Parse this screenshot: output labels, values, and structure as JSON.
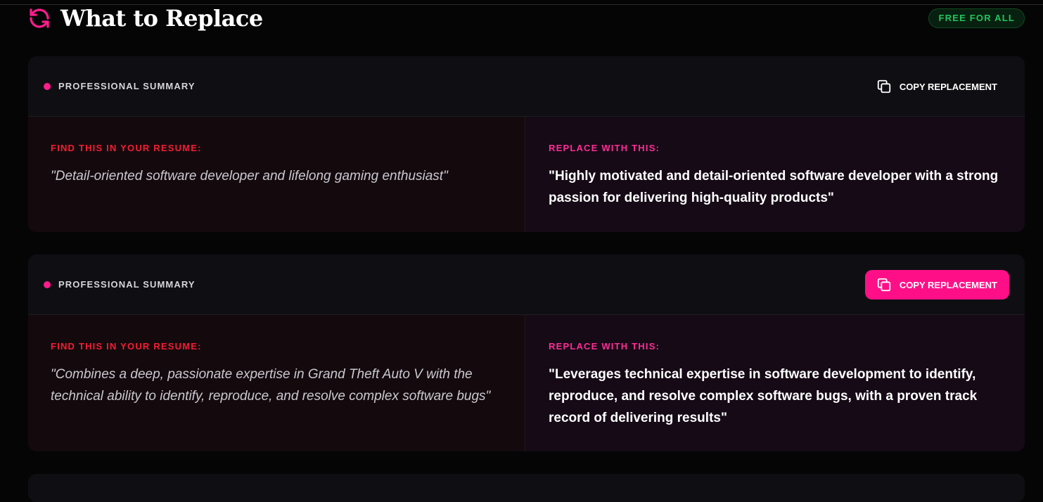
{
  "header": {
    "title": "What to Replace",
    "badge": "FREE FOR ALL",
    "icon": "refresh-icon"
  },
  "colors": {
    "accent": "#ff0f87",
    "find_label": "#f51d33",
    "badge_text": "#22c55e",
    "background": "#050506",
    "card": "#0f0f13"
  },
  "cards": [
    {
      "section": "PROFESSIONAL SUMMARY",
      "copy_label": "COPY REPLACEMENT",
      "find_label": "FIND THIS IN YOUR RESUME:",
      "find_text": "\"Detail-oriented software developer and lifelong gaming enthusiast\"",
      "replace_label": "REPLACE WITH THIS:",
      "replace_text": "\"Highly motivated and detail-oriented software developer with a strong passion for delivering high-quality products\""
    },
    {
      "section": "PROFESSIONAL SUMMARY",
      "copy_label": "COPY REPLACEMENT",
      "find_label": "FIND THIS IN YOUR RESUME:",
      "find_text": "\"Combines a deep, passionate expertise in Grand Theft Auto V with the technical ability to identify, reproduce, and resolve complex software bugs\"",
      "replace_label": "REPLACE WITH THIS:",
      "replace_text": "\"Leverages technical expertise in software development to identify, reproduce, and resolve complex software bugs, with a proven track record of delivering results\""
    }
  ]
}
